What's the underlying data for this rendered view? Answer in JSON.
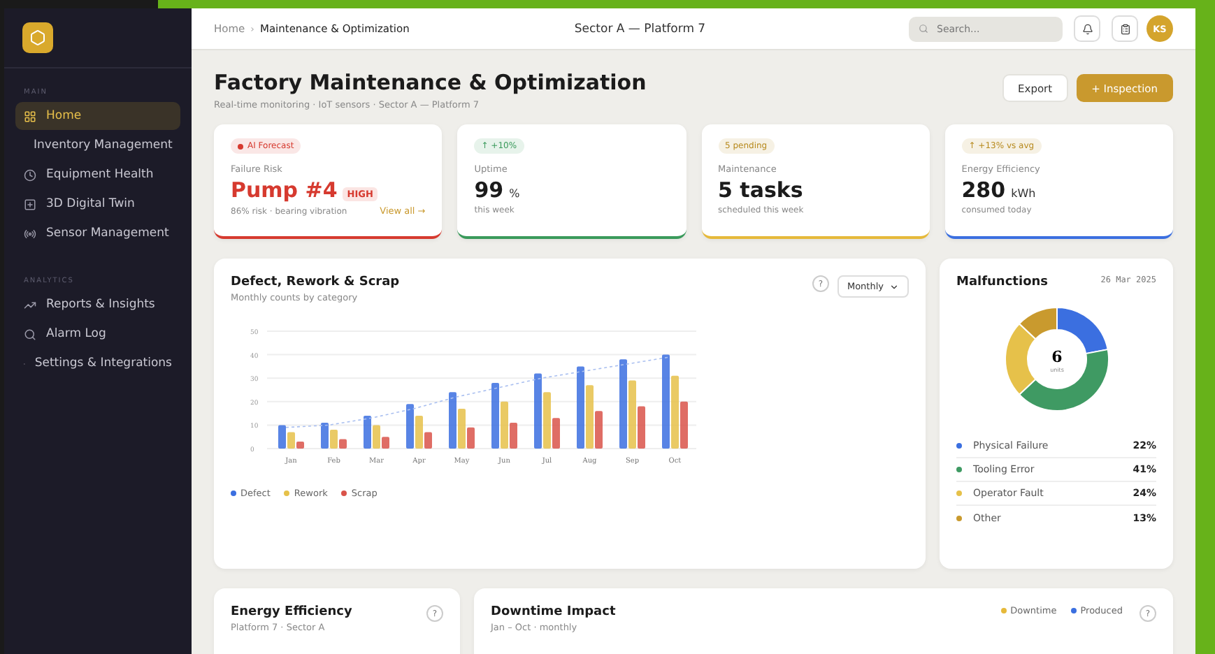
{
  "sidebar": {
    "sections": [
      {
        "label": "MAIN",
        "items": [
          {
            "label": "Home",
            "selected": true
          },
          {
            "label": "Inventory Management",
            "selected": false
          },
          {
            "label": "Equipment Health",
            "selected": false
          },
          {
            "label": "3D Digital Twin",
            "selected": false
          },
          {
            "label": "Sensor Management",
            "selected": false
          }
        ]
      },
      {
        "label": "ANALYTICS",
        "items": [
          {
            "label": "Reports & Insights",
            "selected": false
          },
          {
            "label": "Alarm Log",
            "selected": false
          },
          {
            "label": "Settings & Integrations",
            "selected": false
          }
        ]
      }
    ]
  },
  "header": {
    "breadcrumb": [
      "Home",
      "Maintenance & Optimization"
    ],
    "breadcrumb_separator": "›",
    "location": "Sector A — Platform 7",
    "search": {
      "placeholder": "Search..."
    },
    "avatar": "KS"
  },
  "page": {
    "title": "Factory Maintenance & Optimization",
    "subtitle": "Real-time monitoring · IoT sensors · Sector A — Platform 7",
    "buttons": [
      {
        "label": "Export",
        "kind": "secondary"
      },
      {
        "label": "+ Inspection",
        "kind": "primary"
      }
    ]
  },
  "kpis": [
    {
      "badge": {
        "text": "AI Forecast",
        "color": "#d63a2f"
      },
      "label": "Failure Risk",
      "value": "Pump #4",
      "tag": "HIGH",
      "note": "86% risk · bearing vibration",
      "link": "View all →",
      "color": "#d63a2f"
    },
    {
      "badge": {
        "text": "↑ +10%",
        "color": "#3a9a5b"
      },
      "label": "Uptime",
      "value": "99",
      "unit": "%",
      "note": "this week",
      "color": "#3a9a5b"
    },
    {
      "badge": {
        "text": "5 pending",
        "color": "#b78a1e"
      },
      "label": "Maintenance",
      "value": "5 tasks",
      "note": "scheduled this week",
      "color": "#e6b93a"
    },
    {
      "badge": {
        "text": "↑ +13% vs avg",
        "color": "#b78a1e"
      },
      "label": "Energy Efficiency",
      "value": "280",
      "unit": "kWh",
      "note": "consumed today",
      "color": "#3b6fe0"
    }
  ],
  "defects": {
    "title": "Defect, Rework & Scrap",
    "subtitle": "Monthly counts by category",
    "help": "?",
    "period": "Monthly",
    "chart_data": {
      "type": "bar",
      "grid": true,
      "categories": [
        "Jan",
        "Feb",
        "Mar",
        "Apr",
        "May",
        "Jun",
        "Jul",
        "Aug",
        "Sep",
        "Oct"
      ],
      "ylim": [
        0,
        50
      ],
      "yticks": [
        0,
        10,
        20,
        30,
        40,
        50
      ],
      "series": [
        {
          "name": "Defect",
          "color": "#3b6fe0",
          "values": [
            10,
            11,
            14,
            19,
            24,
            28,
            32,
            35,
            38,
            40
          ]
        },
        {
          "name": "Rework",
          "color": "#e6c14a",
          "values": [
            7,
            8,
            10,
            14,
            17,
            20,
            24,
            27,
            29,
            31
          ]
        },
        {
          "name": "Scrap",
          "color": "#d9534a",
          "values": [
            3,
            4,
            5,
            7,
            9,
            11,
            13,
            16,
            18,
            20
          ]
        },
        {
          "type": "line",
          "line_style": "dashed",
          "color": "#a9bff0",
          "values": [
            9,
            10,
            13,
            17,
            22,
            26,
            30,
            33,
            36,
            39
          ]
        }
      ]
    }
  },
  "malfunctions": {
    "title": "Malfunctions",
    "date": "26 Mar 2025",
    "total": "6",
    "total_label": "units",
    "chart_data": {
      "type": "donut",
      "categories": [
        "Physical Failure",
        "Tooling Error",
        "Operator Fault",
        "Other"
      ],
      "series": [
        {
          "values": [
            22,
            41,
            24,
            13
          ]
        }
      ]
    },
    "items": [
      {
        "value": "22%",
        "color": "#3b6fe0"
      },
      {
        "value": "41%",
        "color": "#3f9a63"
      },
      {
        "value": "24%",
        "color": "#e6c14a"
      },
      {
        "value": "13%",
        "color": "#c99a2e"
      }
    ]
  },
  "energy": {
    "title": "Energy Efficiency",
    "subtitle": "Platform 7 · Sector A",
    "help": "?"
  },
  "downtime": {
    "title": "Downtime Impact",
    "subtitle": "Jan – Oct · monthly",
    "legend": [
      {
        "label": "Downtime",
        "color": "#e6b93a"
      },
      {
        "label": "Produced",
        "color": "#3b6fe0"
      }
    ],
    "help": "?"
  }
}
